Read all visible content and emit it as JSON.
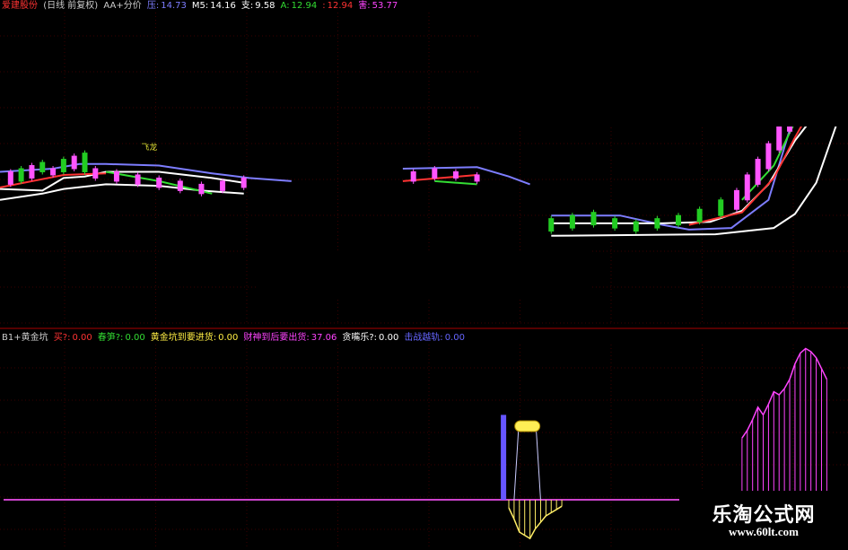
{
  "header_top": {
    "stock_name": "爱建股份",
    "period": "(日线 前复权)",
    "indicator": "AA+分价",
    "items": [
      {
        "label": "压:",
        "value": "14.73",
        "color": "#7d7dff"
      },
      {
        "label": "M5:",
        "value": "14.16",
        "color": "#ffffff"
      },
      {
        "label": "支:",
        "value": "9.58",
        "color": "#ffffff"
      },
      {
        "label": "A:",
        "value": "12.94",
        "color": "#33dd33"
      },
      {
        "label": ":",
        "value": "12.94",
        "color": "#ff3333"
      },
      {
        "label": "害:",
        "value": "53.77",
        "color": "#ff44ff"
      }
    ]
  },
  "header_bottom": {
    "indicator": "B1+黄金坑",
    "items": [
      {
        "label": "买?:",
        "value": "0.00",
        "color": "#ff3333"
      },
      {
        "label": "春笋?:",
        "value": "0.00",
        "color": "#33dd33"
      },
      {
        "label": "黄金坑到要进货:",
        "value": "0.00",
        "color": "#ffee44"
      },
      {
        "label": "财神到后要出货:",
        "value": "37.06",
        "color": "#ff44ff"
      },
      {
        "label": "贪嘴乐?:",
        "value": "0.00",
        "color": "#ffffff"
      },
      {
        "label": "击战越轨:",
        "value": "0.00",
        "color": "#6666ff"
      }
    ]
  },
  "watermark": {
    "title": "乐淘公式网",
    "url": "www.60lt.com"
  },
  "chart_data": [
    {
      "type": "candlestick",
      "panel": "main",
      "note_labels": [
        "飞龙"
      ],
      "ylim": [
        7,
        17
      ],
      "n": 160,
      "series": [
        {
          "name": "压",
          "color": "#7d7dff",
          "segments": [
            [
              [
                0,
                11.9
              ],
              [
                10,
                12.0
              ],
              [
                15,
                12.15
              ],
              [
                20,
                12.15
              ],
              [
                30,
                12.1
              ],
              [
                40,
                11.85
              ],
              [
                47,
                11.7
              ],
              [
                55,
                11.6
              ]
            ],
            [
              [
                76,
                12.0
              ],
              [
                90,
                12.05
              ],
              [
                96,
                11.75
              ],
              [
                100,
                11.5
              ]
            ],
            [
              [
                104,
                10.5
              ],
              [
                110,
                10.5
              ],
              [
                117,
                10.5
              ],
              [
                125,
                10.2
              ],
              [
                130,
                10.05
              ],
              [
                138,
                10.1
              ],
              [
                145,
                11.0
              ],
              [
                150,
                13.8
              ],
              [
                154,
                17
              ]
            ]
          ]
        },
        {
          "name": "M5",
          "color": "#ffffff",
          "segments": [
            [
              [
                0,
                11.0
              ],
              [
                8,
                11.2
              ],
              [
                12,
                11.35
              ],
              [
                20,
                11.5
              ],
              [
                30,
                11.45
              ],
              [
                38,
                11.3
              ],
              [
                46,
                11.2
              ]
            ],
            [
              [
                104,
                10.25
              ],
              [
                125,
                10.25
              ],
              [
                134,
                10.3
              ],
              [
                140,
                10.65
              ],
              [
                145,
                11.5
              ],
              [
                150,
                12.9
              ],
              [
                155,
                14.0
              ],
              [
                158,
                15.0
              ]
            ]
          ]
        },
        {
          "name": "支",
          "color": "#ffffff",
          "segments": [
            [
              [
                0,
                11.35
              ],
              [
                8,
                11.3
              ],
              [
                12,
                11.7
              ],
              [
                16,
                11.75
              ],
              [
                20,
                11.9
              ],
              [
                30,
                11.9
              ],
              [
                40,
                11.7
              ],
              [
                46,
                11.55
              ]
            ],
            [
              [
                104,
                9.85
              ],
              [
                135,
                9.9
              ],
              [
                146,
                10.1
              ],
              [
                150,
                10.55
              ],
              [
                154,
                11.55
              ],
              [
                158,
                13.5
              ],
              [
                160,
                14.0
              ]
            ]
          ]
        },
        {
          "name": "A",
          "color": "#33dd33",
          "segments": [
            [
              [
                20,
                11.9
              ],
              [
                30,
                11.6
              ],
              [
                40,
                11.2
              ]
            ],
            [
              [
                82,
                11.6
              ],
              [
                90,
                11.5
              ]
            ],
            [
              [
                140,
                11.0
              ],
              [
                146,
                12.1
              ],
              [
                150,
                13.5
              ],
              [
                156,
                16.0
              ]
            ]
          ]
        },
        {
          "name": "",
          "color": "#ff3333",
          "segments": [
            [
              [
                0,
                11.4
              ],
              [
                12,
                11.8
              ],
              [
                20,
                11.85
              ]
            ],
            [
              [
                76,
                11.6
              ],
              [
                90,
                11.8
              ]
            ],
            [
              [
                130,
                10.2
              ],
              [
                140,
                10.6
              ],
              [
                146,
                11.7
              ],
              [
                150,
                13.0
              ],
              [
                155,
                14.5
              ],
              [
                158,
                15.5
              ]
            ]
          ]
        }
      ],
      "candles": [
        [
          2,
          11.5,
          11.9
        ],
        [
          4,
          11.6,
          12.0
        ],
        [
          6,
          11.7,
          12.1
        ],
        [
          8,
          11.9,
          12.2
        ],
        [
          10,
          11.8,
          12.0
        ],
        [
          12,
          11.9,
          12.3
        ],
        [
          14,
          12.0,
          12.4
        ],
        [
          16,
          11.9,
          12.5
        ],
        [
          18,
          11.7,
          12.0
        ],
        [
          22,
          11.6,
          11.9
        ],
        [
          26,
          11.5,
          11.8
        ],
        [
          30,
          11.4,
          11.7
        ],
        [
          34,
          11.3,
          11.6
        ],
        [
          38,
          11.2,
          11.5
        ],
        [
          42,
          11.3,
          11.6
        ],
        [
          46,
          11.4,
          11.7
        ],
        [
          78,
          11.6,
          11.9
        ],
        [
          82,
          11.7,
          12.0
        ],
        [
          86,
          11.7,
          11.9
        ],
        [
          90,
          11.6,
          11.8
        ],
        [
          104,
          10.0,
          10.4
        ],
        [
          108,
          10.1,
          10.5
        ],
        [
          112,
          10.2,
          10.6
        ],
        [
          116,
          10.1,
          10.4
        ],
        [
          120,
          10.0,
          10.3
        ],
        [
          124,
          10.1,
          10.4
        ],
        [
          128,
          10.2,
          10.5
        ],
        [
          132,
          10.3,
          10.7
        ],
        [
          136,
          10.5,
          11.0
        ],
        [
          139,
          10.7,
          11.3
        ],
        [
          141,
          11.0,
          11.8
        ],
        [
          143,
          11.5,
          12.3
        ],
        [
          145,
          12.0,
          12.8
        ],
        [
          147,
          12.6,
          13.4
        ],
        [
          149,
          13.2,
          14.2
        ],
        [
          151,
          14.0,
          15.0
        ],
        [
          153,
          14.7,
          15.9
        ],
        [
          155,
          15.5,
          16.9
        ]
      ]
    },
    {
      "type": "bar",
      "panel": "indicator",
      "ylim": [
        0,
        100
      ],
      "baseline": 0,
      "series": [
        {
          "name": "黄金坑到要进货",
          "color": "#6655ff",
          "x": [
            95
          ],
          "values": [
            55
          ]
        },
        {
          "name": "财神到后要出货",
          "color": "#ff44ff",
          "x": [
            140,
            141,
            142,
            143,
            144,
            145,
            146,
            147,
            148,
            149,
            150,
            151,
            152,
            153,
            154,
            155,
            156
          ],
          "values": [
            40,
            45,
            52,
            60,
            55,
            62,
            70,
            68,
            72,
            78,
            88,
            95,
            98,
            96,
            92,
            85,
            78
          ]
        }
      ],
      "pit": {
        "x": [
          96,
          97,
          98,
          99,
          100,
          101,
          102,
          103,
          104,
          105,
          106
        ],
        "values": [
          -5,
          -12,
          -20,
          -22,
          -24,
          -18,
          -14,
          -10,
          -8,
          -6,
          -4
        ],
        "color": "#ffee66"
      }
    }
  ]
}
